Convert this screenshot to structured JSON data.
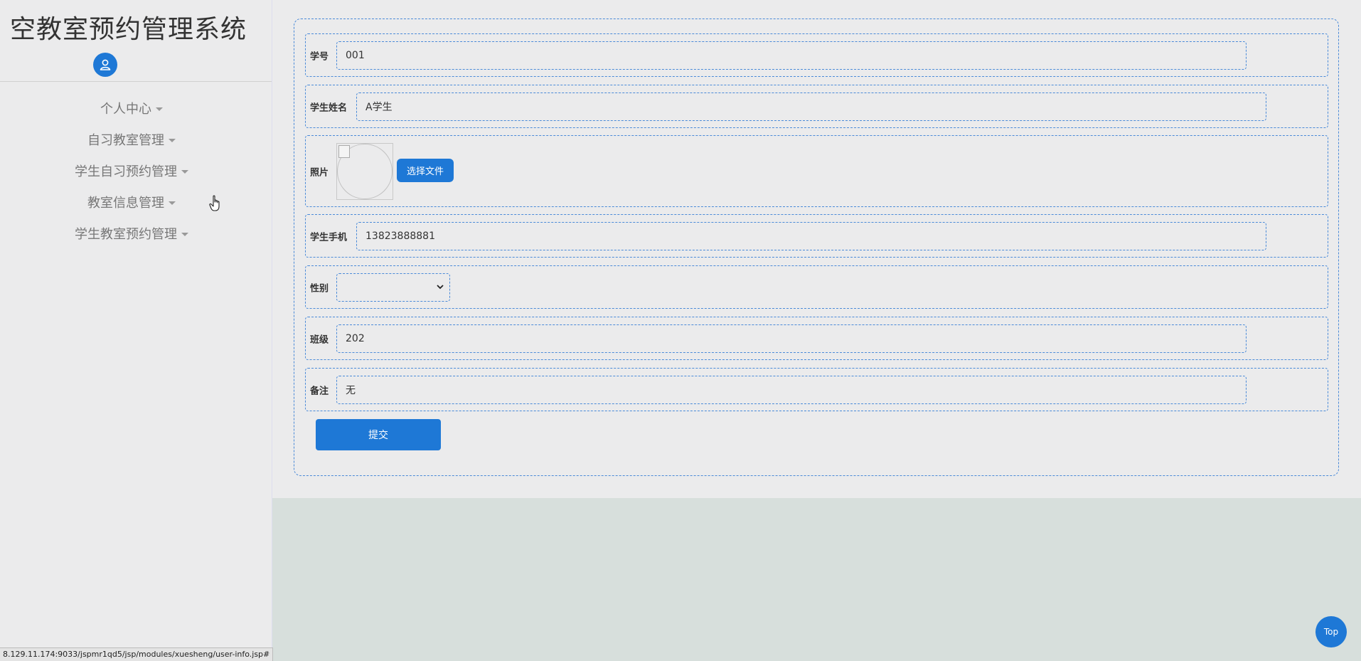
{
  "app": {
    "title": "空教室预约管理系统"
  },
  "sidebar": {
    "items": [
      {
        "label": "个人中心"
      },
      {
        "label": "自习教室管理"
      },
      {
        "label": "学生自习预约管理"
      },
      {
        "label": "教室信息管理"
      },
      {
        "label": "学生教室预约管理"
      }
    ]
  },
  "form": {
    "student_id": {
      "label": "学号",
      "value": "001"
    },
    "student_name": {
      "label": "学生姓名",
      "value": "A学生"
    },
    "photo": {
      "label": "照片",
      "button": "选择文件"
    },
    "phone": {
      "label": "学生手机",
      "value": "13823888881"
    },
    "gender": {
      "label": "性别",
      "value": ""
    },
    "class": {
      "label": "班级",
      "value": "202"
    },
    "remark": {
      "label": "备注",
      "value": "无"
    },
    "submit": "提交"
  },
  "top_button": "Top",
  "status_url": "8.129.11.174:9033/jspmr1qd5/jsp/modules/xuesheng/user-info.jsp#",
  "colors": {
    "accent": "#1e78d6",
    "border": "#4a8ad8",
    "panel": "#ebebec",
    "background": "#d7dfdc"
  },
  "icons": {
    "avatar": "user-icon",
    "dropdown": "caret-down-icon",
    "cursor": "hand-pointer-icon"
  }
}
